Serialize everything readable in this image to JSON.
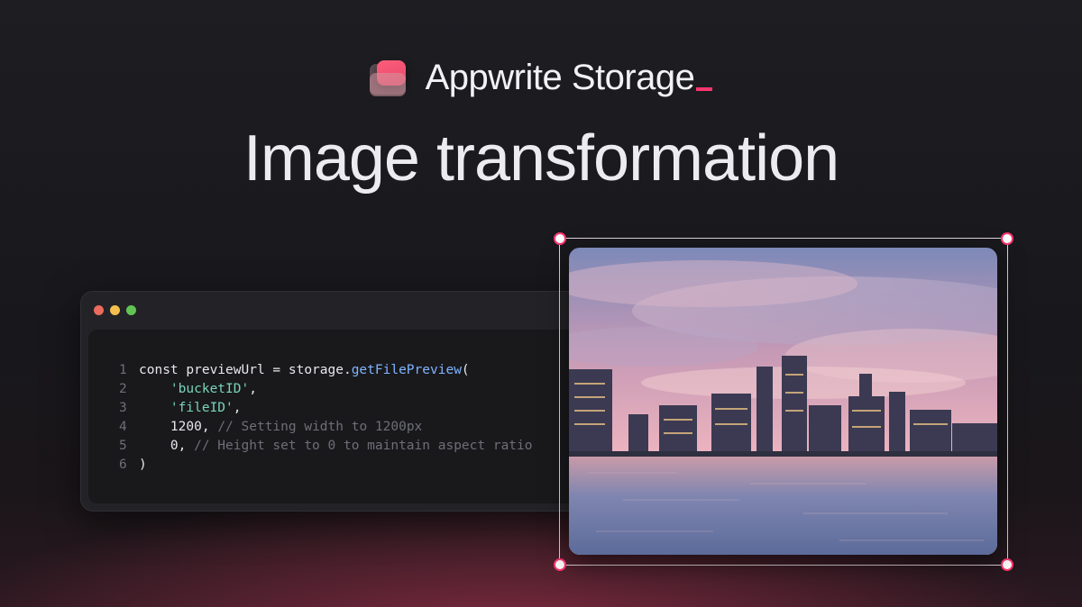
{
  "brand": {
    "name": "Appwrite Storage"
  },
  "headline": "Image transformation",
  "code": {
    "lines": [
      {
        "num": "1",
        "parts": [
          {
            "t": "const previewUrl = storage.",
            "c": "text"
          },
          {
            "t": "getFilePreview",
            "c": "fn"
          },
          {
            "t": "(",
            "c": "text"
          }
        ]
      },
      {
        "num": "2",
        "parts": [
          {
            "t": "    ",
            "c": "text"
          },
          {
            "t": "'bucketID'",
            "c": "str"
          },
          {
            "t": ",",
            "c": "text"
          }
        ]
      },
      {
        "num": "3",
        "parts": [
          {
            "t": "    ",
            "c": "text"
          },
          {
            "t": "'fileID'",
            "c": "str"
          },
          {
            "t": ",",
            "c": "text"
          }
        ]
      },
      {
        "num": "4",
        "parts": [
          {
            "t": "    1200, ",
            "c": "text"
          },
          {
            "t": "// Setting width to 1200px",
            "c": "cmt"
          }
        ]
      },
      {
        "num": "5",
        "parts": [
          {
            "t": "    0, ",
            "c": "text"
          },
          {
            "t": "// Height set to 0 to maintain aspect ratio",
            "c": "cmt"
          }
        ]
      },
      {
        "num": "6",
        "parts": [
          {
            "t": ")",
            "c": "text"
          }
        ]
      }
    ]
  },
  "colors": {
    "accent": "#fd366e",
    "background": "#1b1b1f"
  },
  "image": {
    "subject": "city-skyline-at-sunset-photo"
  }
}
